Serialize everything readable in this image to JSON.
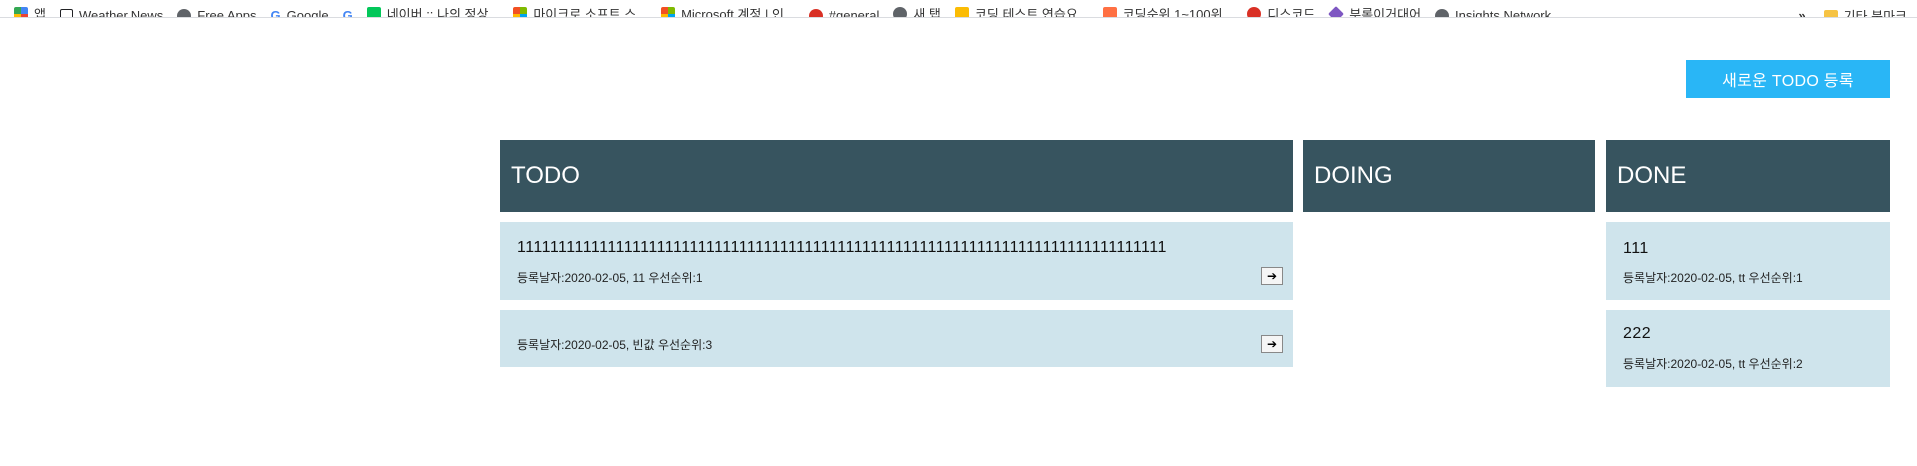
{
  "bookmarks": {
    "items": [
      {
        "label": "앱",
        "icon": "apps-grid-icon",
        "color": "#4285f4"
      },
      {
        "label": "Weather,News",
        "icon": "bookmark-page-icon",
        "color": "#202124"
      },
      {
        "label": "Free Apps",
        "icon": "globe-icon",
        "color": "#5f6368"
      },
      {
        "label": "Google",
        "icon": "google-icon",
        "color": "#4285f4"
      },
      {
        "label": "",
        "icon": "google-icon",
        "color": "#4285f4"
      },
      {
        "label": "네이버 :: 나의 정상...",
        "icon": "naver-icon",
        "color": "#03c75a"
      },
      {
        "label": "마이크로 소프트 스...",
        "icon": "microsoft-icon",
        "color": "#f25022"
      },
      {
        "label": "Microsoft 계정 | 인...",
        "icon": "microsoft-icon",
        "color": "#f25022"
      },
      {
        "label": "#general",
        "icon": "notification-badge-icon",
        "color": "#d93025"
      },
      {
        "label": "새 탭",
        "icon": "globe-icon",
        "color": "#5f6368"
      },
      {
        "label": "코딩 테스트 연습요...",
        "icon": "puzzle-icon",
        "color": "#fbbc04"
      },
      {
        "label": "코딩순위 1~100위...",
        "icon": "chart-icon",
        "color": "#ff7043"
      },
      {
        "label": "디스코드",
        "icon": "notification-badge-icon",
        "color": "#d93025"
      },
      {
        "label": "부록이거대어",
        "icon": "tag-icon",
        "color": "#7e57c2"
      },
      {
        "label": "Insights Network",
        "icon": "globe-icon",
        "color": "#5f6368"
      }
    ],
    "overflow_label": "»",
    "other_bookmarks_label": "기타 북마크"
  },
  "register_button": "새로운 TODO 등록",
  "columns": {
    "todo": {
      "title": "TODO",
      "cards": [
        {
          "title": "1111111111111111111111111111111111111111111111111111111111111111111111111111111",
          "meta": "등록날자:2020-02-05, 11 우선순위:1",
          "action": "➔"
        },
        {
          "title": "",
          "meta": "등록날자:2020-02-05, 빈값 우선순위:3",
          "action": "➔"
        }
      ]
    },
    "doing": {
      "title": "DOING",
      "cards": []
    },
    "done": {
      "title": "DONE",
      "cards": [
        {
          "title": "111",
          "meta": "등록날자:2020-02-05, tt 우선순위:1"
        },
        {
          "title": "222",
          "meta": "등록날자:2020-02-05, tt 우선순위:2"
        }
      ]
    }
  },
  "colors": {
    "header_bg": "#37545f",
    "card_bg": "#cfe4ec",
    "button_bg": "#29b6f6"
  }
}
